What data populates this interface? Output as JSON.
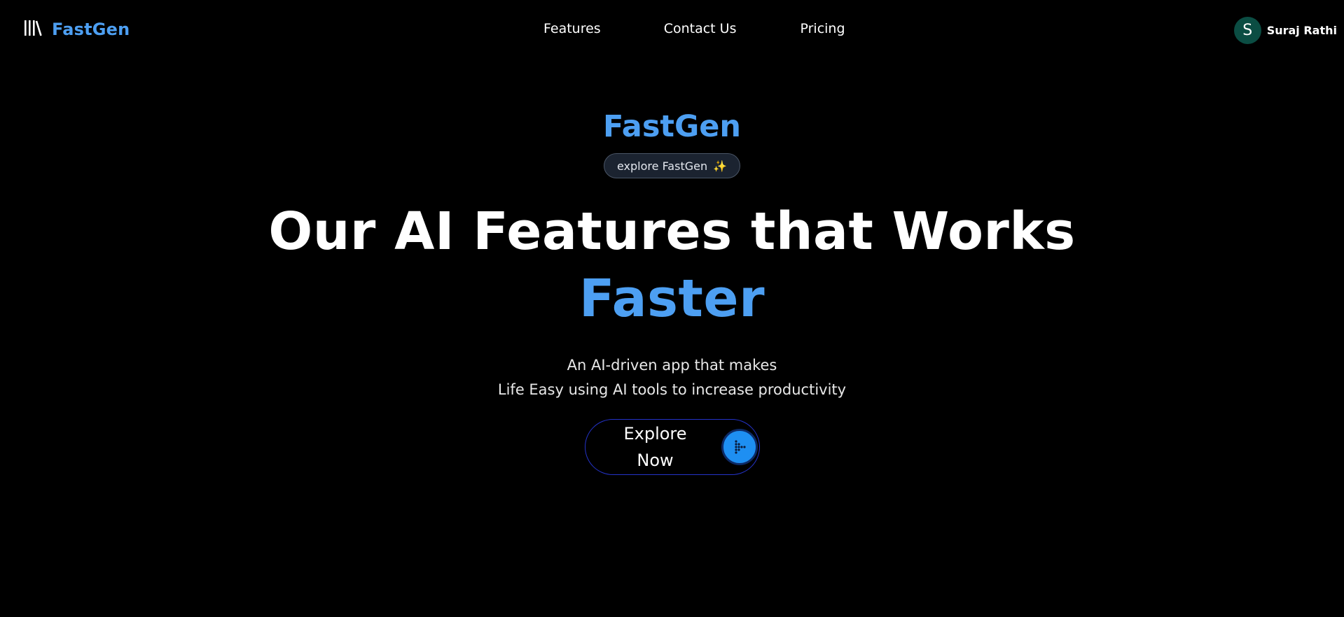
{
  "navbar": {
    "brand": "FastGen",
    "brand_icon": "library-books-icon",
    "links": [
      "Features",
      "Contact Us",
      "Pricing"
    ],
    "user": {
      "initial": "S",
      "name": "Suraj Rathi"
    }
  },
  "hero": {
    "brand": "FastGen",
    "pill_label": "explore FastGen",
    "pill_icon": "✨",
    "headline_line1": "Our AI Features that Works",
    "headline_line2": "Faster",
    "subtitle_line1": "An AI-driven app that makes",
    "subtitle_line2": "Life Easy using AI tools to increase productivity",
    "cta_label_line1": "Explore",
    "cta_label_line2": "Now",
    "cta_icon": "dotted-arrow-right-icon"
  },
  "colors": {
    "accent": "#4d9ff2",
    "background": "#000000",
    "avatar": "#0b4d43",
    "cta_border": "#2433c9",
    "cta_button": "#1e8ff2"
  }
}
